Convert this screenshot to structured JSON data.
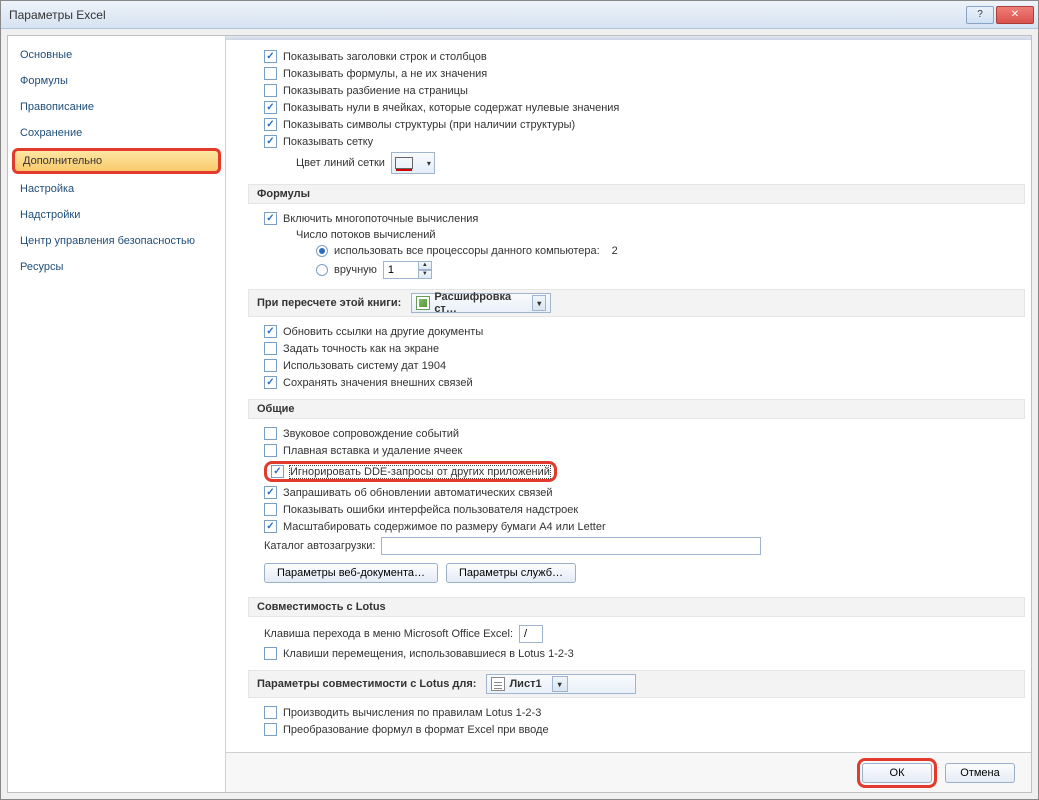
{
  "window": {
    "title": "Параметры Excel"
  },
  "nav": [
    "Основные",
    "Формулы",
    "Правописание",
    "Сохранение",
    "Дополнительно",
    "Настройка",
    "Надстройки",
    "Центр управления безопасностью",
    "Ресурсы"
  ],
  "display_worksheet": {
    "headers": "Показывать заголовки строк и столбцов",
    "formulas": "Показывать формулы, а не их значения",
    "page_breaks": "Показывать разбиение на страницы",
    "zeros": "Показывать нули в ячейках, которые содержат нулевые значения",
    "outline": "Показывать символы структуры (при наличии структуры)",
    "gridlines": "Показывать сетку",
    "grid_color_label": "Цвет линий сетки"
  },
  "formulas": {
    "header": "Формулы",
    "multi": "Включить многопоточные вычисления",
    "threads_label": "Число потоков вычислений",
    "use_all": "использовать все процессоры данного компьютера:",
    "count": "2",
    "manual": "вручную",
    "manual_value": "1"
  },
  "recalc": {
    "header": "При пересчете этой книги:",
    "book": "Расшифровка ст…",
    "update_links": "Обновить ссылки на другие документы",
    "precision": "Задать точность как на экране",
    "date1904": "Использовать систему дат 1904",
    "save_ext": "Сохранять значения внешних связей"
  },
  "general": {
    "header": "Общие",
    "sound": "Звуковое сопровождение событий",
    "smooth": "Плавная вставка и удаление ячеек",
    "dde": "Игнорировать DDE-запросы от других приложений",
    "auto_links": "Запрашивать об обновлении автоматических связей",
    "addin_errors": "Показывать ошибки интерфейса пользователя надстроек",
    "scale_a4": "Масштабировать содержимое по размеру бумаги А4 или Letter",
    "startup_label": "Каталог автозагрузки:",
    "startup_value": "",
    "web_btn": "Параметры веб-документа…",
    "service_btn": "Параметры служб…"
  },
  "lotus": {
    "header": "Совместимость с Lotus",
    "menu_key_label": "Клавиша перехода в меню Microsoft Office Excel:",
    "menu_key_value": "/",
    "nav_keys": "Клавиши перемещения, использовавшиеся в Lotus 1-2-3"
  },
  "lotus_compat": {
    "header": "Параметры совместимости с Lotus для:",
    "sheet": "Лист1",
    "calc_123": "Производить вычисления по правилам Lotus 1-2-3",
    "convert": "Преобразование формул в формат Excel при вводе"
  },
  "footer": {
    "ok": "ОК",
    "cancel": "Отмена"
  }
}
